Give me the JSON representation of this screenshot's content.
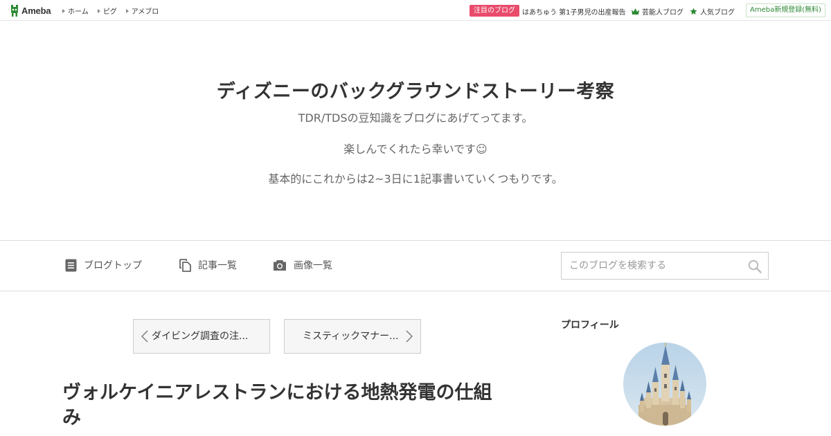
{
  "topbar": {
    "logo_text": "Ameba",
    "nav": [
      "ホーム",
      "ピグ",
      "アメブロ"
    ],
    "attention_badge": "注目のブログ",
    "attention_blog": "はあちゅう 第1子男児の出産報告",
    "celebrity_blog": "芸能人ブログ",
    "popular_blog": "人気ブログ",
    "register": "Ameba新規登録(無料)"
  },
  "header": {
    "title": "ディズニーのバックグラウンドストーリー考察",
    "description": [
      "TDR/TDSの豆知識をブログにあげてってます。",
      "楽しんでくれたら幸いです☺",
      "基本的にこれからは2~3日に1記事書いていくつもりです。"
    ]
  },
  "blog_nav": {
    "items": [
      "ブログトップ",
      "記事一覧",
      "画像一覧"
    ],
    "search_placeholder": "このブログを検索する"
  },
  "article": {
    "prev_label": "ダイビング調査の注...",
    "next_label": "ミスティックマナー...",
    "title": "ヴォルケイニアレストランにおける地熱発電の仕組み"
  },
  "sidebar": {
    "profile_heading": "プロフィール"
  },
  "colors": {
    "ameba_green": "#2d8a34",
    "attention_pink": "#e94b6b"
  },
  "icons": {
    "blog_top": "document-icon",
    "entries": "copy-pages-icon",
    "images": "camera-icon",
    "search": "search-icon",
    "celebrity": "crown-icon",
    "popular": "star-icon"
  }
}
